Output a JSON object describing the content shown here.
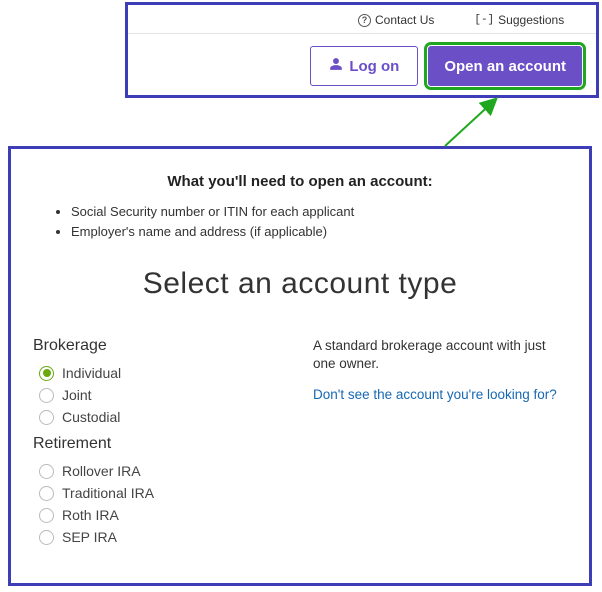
{
  "topLinks": {
    "contact": "Contact Us",
    "suggestions": "Suggestions"
  },
  "buttons": {
    "logon": "Log on",
    "openAccount": "Open an account"
  },
  "need": {
    "title": "What you'll need to open an account:",
    "items": [
      "Social Security number or ITIN for each applicant",
      "Employer's name and address (if applicable)"
    ]
  },
  "selectTitle": "Select an account type",
  "groups": {
    "brokerage": {
      "title": "Brokerage",
      "options": [
        "Individual",
        "Joint",
        "Custodial"
      ],
      "selected": "Individual"
    },
    "retirement": {
      "title": "Retirement",
      "options": [
        "Rollover IRA",
        "Traditional IRA",
        "Roth IRA",
        "SEP IRA"
      ]
    }
  },
  "description": "A standard brokerage account with just one owner.",
  "helpLink": "Don't see the account you're looking for?"
}
